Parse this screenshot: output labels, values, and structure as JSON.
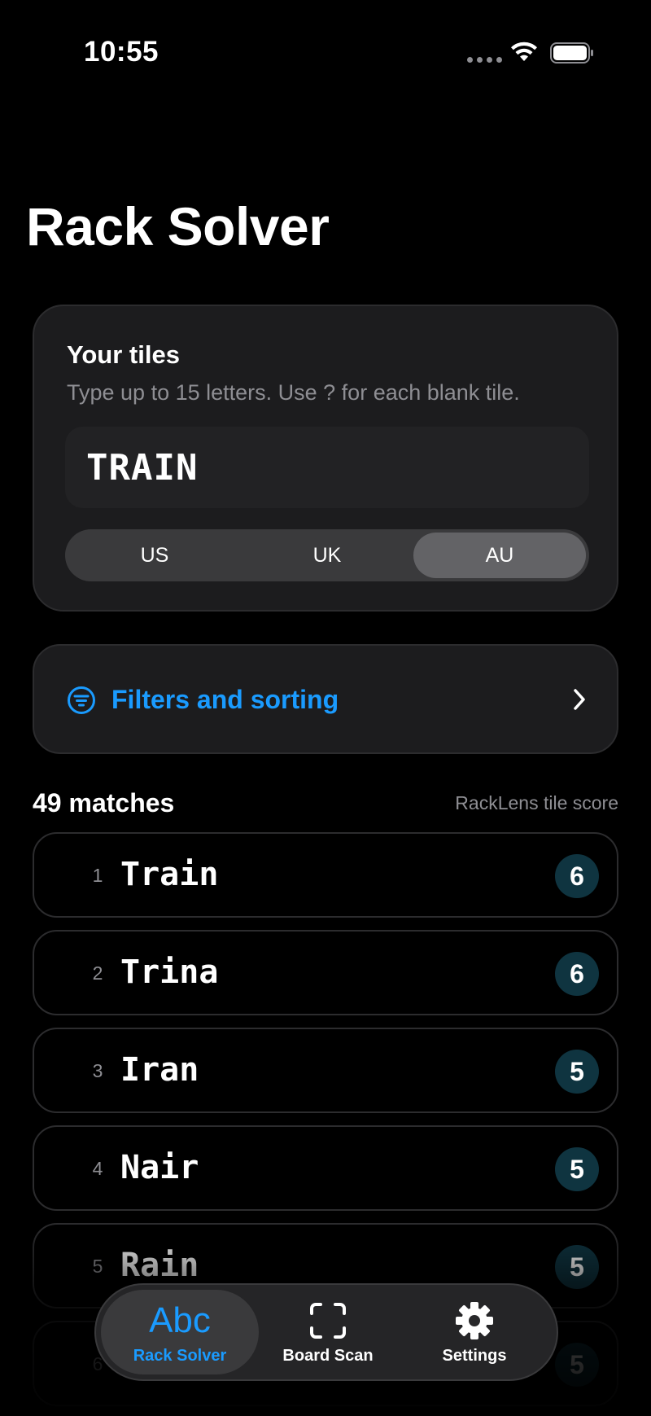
{
  "status": {
    "time": "10:55"
  },
  "title": "Rack Solver",
  "tiles": {
    "heading": "Your tiles",
    "help": "Type up to 15 letters. Use ? for each blank tile.",
    "value": "TRAIN",
    "dictionaries": [
      {
        "label": "US",
        "selected": false
      },
      {
        "label": "UK",
        "selected": false
      },
      {
        "label": "AU",
        "selected": true
      }
    ]
  },
  "filters": {
    "label": "Filters and sorting"
  },
  "results": {
    "count_label": "49 matches",
    "score_caption": "RackLens tile score",
    "rows": [
      {
        "index": "1",
        "word": "Train",
        "score": "6"
      },
      {
        "index": "2",
        "word": "Trina",
        "score": "6"
      },
      {
        "index": "3",
        "word": "Iran",
        "score": "5"
      },
      {
        "index": "4",
        "word": "Nair",
        "score": "5"
      },
      {
        "index": "5",
        "word": "Rain",
        "score": "5"
      },
      {
        "index": "6",
        "word": "",
        "score": "5"
      }
    ]
  },
  "tabbar": {
    "tabs": [
      {
        "icon_text": "Abc",
        "icon": "abc-icon",
        "label": "Rack Solver",
        "active": true
      },
      {
        "icon_text": "",
        "icon": "scan-frame-icon",
        "label": "Board Scan",
        "active": false
      },
      {
        "icon_text": "",
        "icon": "gear-icon",
        "label": "Settings",
        "active": false
      }
    ]
  },
  "colors": {
    "accent": "#1a9bff",
    "card": "#1c1c1e",
    "score_badge": "#0f3440"
  }
}
